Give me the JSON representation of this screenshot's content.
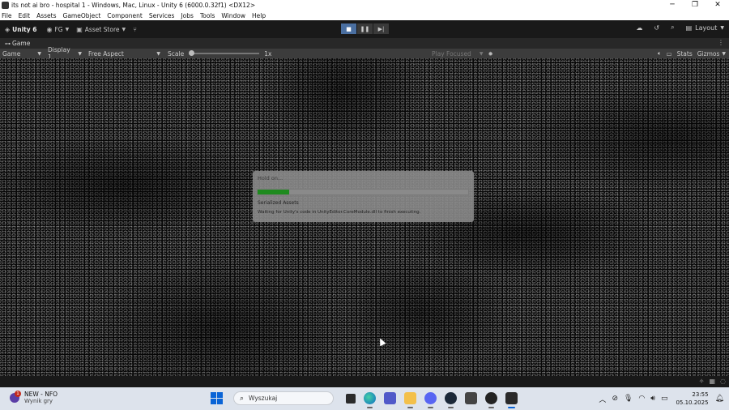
{
  "window": {
    "title": "its not ai bro - hospital 1 - Windows, Mac, Linux - Unity 6 (6000.0.32f1) <DX12>",
    "controls": {
      "minimize": "─",
      "restore": "❐",
      "close": "✕"
    }
  },
  "menu": [
    "File",
    "Edit",
    "Assets",
    "GameObject",
    "Component",
    "Services",
    "Jobs",
    "Tools",
    "Window",
    "Help"
  ],
  "toolbar": {
    "unity_label": "Unity 6",
    "account_label": "FG",
    "asset_store_label": "Asset Store",
    "layout_label": "Layout",
    "play_state": "playing"
  },
  "tab": {
    "label": "Game"
  },
  "game_bar": {
    "mode": "Game",
    "display": "Display 1",
    "aspect": "Free Aspect",
    "scale_label": "Scale",
    "scale_value": "1x",
    "play_focused": "Play Focused",
    "stats_label": "Stats",
    "gizmos_label": "Gizmos"
  },
  "dialog": {
    "title": "Hold on...",
    "progress": 0.15,
    "line1": "Serialized Assets",
    "line2": "Waiting for Unity's code in UnityEditor.CoreModule.dll to finish executing."
  },
  "taskbar": {
    "widget_badge": "1",
    "widget_title": "NEW - NFO",
    "widget_subtitle": "Wynik gry",
    "search_placeholder": "Wyszukaj",
    "time": "23:55",
    "date": "05.10.2025"
  },
  "colors": {
    "accent": "#4a6fa1",
    "progress_fill": "#1e8a1e",
    "taskbar_bg": "#dde3ec",
    "editor_bg": "#191919"
  }
}
